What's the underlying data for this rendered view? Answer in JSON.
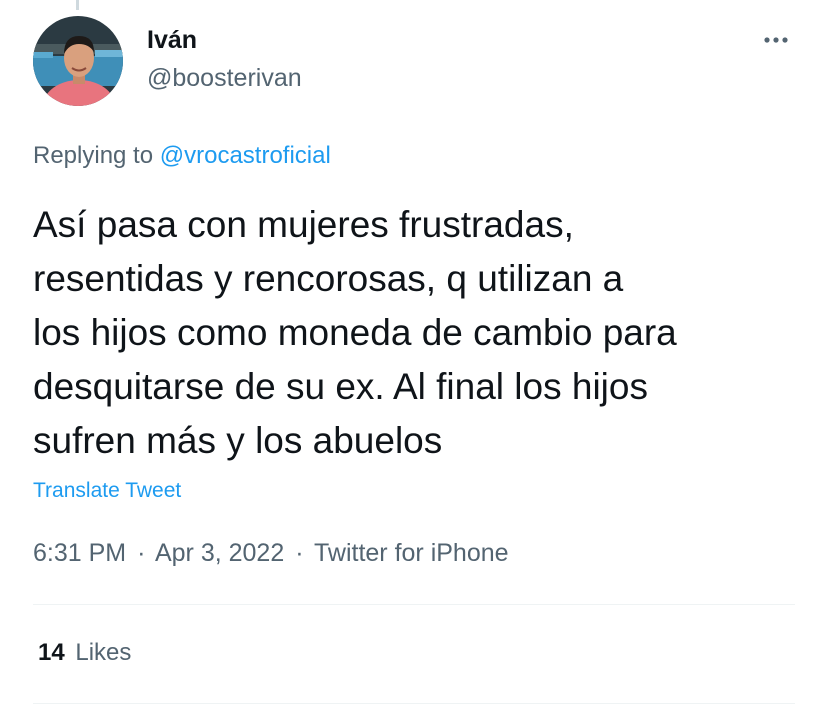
{
  "tweet": {
    "author": {
      "display_name": "Iván",
      "handle": "@boosterivan"
    },
    "menu_icon": "more-horizontal-icon",
    "replying_to": {
      "prefix": "Replying to",
      "mention": "@vrocastroficial"
    },
    "text_lines": [
      "Así pasa con mujeres frustradas,",
      "resentidas y rencorosas, q utilizan a",
      "los hijos como moneda de cambio para",
      "desquitarse de su ex. Al final los hijos",
      "sufren más y los abuelos"
    ],
    "translate_label": "Translate Tweet",
    "time": "6:31 PM",
    "separator": "·",
    "date": "Apr 3, 2022",
    "source": "Twitter for iPhone",
    "likes": {
      "count": "14",
      "label": "Likes"
    }
  },
  "colors": {
    "text_primary": "#0f1419",
    "text_secondary": "#536471",
    "link": "#1d9bf0",
    "divider": "#eff3f4"
  }
}
